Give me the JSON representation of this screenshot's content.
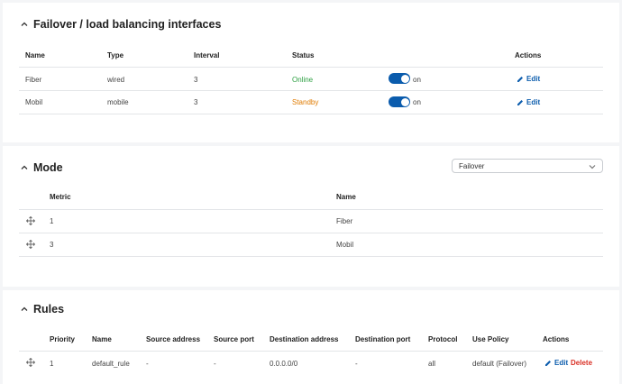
{
  "interfaces": {
    "title": "Failover / load balancing interfaces",
    "headers": {
      "name": "Name",
      "type": "Type",
      "interval": "Interval",
      "status": "Status",
      "actions": "Actions"
    },
    "rows": [
      {
        "name": "Fiber",
        "type": "wired",
        "interval": "3",
        "status": "Online",
        "toggle": "on",
        "action": "Edit"
      },
      {
        "name": "Mobil",
        "type": "mobile",
        "interval": "3",
        "status": "Standby",
        "toggle": "on",
        "action": "Edit"
      }
    ]
  },
  "mode": {
    "title": "Mode",
    "select_value": "Failover",
    "headers": {
      "metric": "Metric",
      "name": "Name"
    },
    "rows": [
      {
        "metric": "1",
        "name": "Fiber"
      },
      {
        "metric": "3",
        "name": "Mobil"
      }
    ]
  },
  "rules": {
    "title": "Rules",
    "headers": {
      "priority": "Priority",
      "name": "Name",
      "source_address": "Source address",
      "source_port": "Source port",
      "destination_address": "Destination address",
      "destination_port": "Destination port",
      "protocol": "Protocol",
      "use_policy": "Use Policy",
      "actions": "Actions"
    },
    "rows": [
      {
        "priority": "1",
        "name": "default_rule",
        "source_address": "-",
        "source_port": "-",
        "destination_address": "0.0.0.0/0",
        "destination_port": "-",
        "protocol": "all",
        "use_policy": "default (Failover)",
        "edit": "Edit",
        "delete": "Delete"
      }
    ]
  },
  "colors": {
    "accent": "#0b5cad",
    "online": "#2ea043",
    "standby": "#e07b00",
    "delete": "#d93025"
  }
}
